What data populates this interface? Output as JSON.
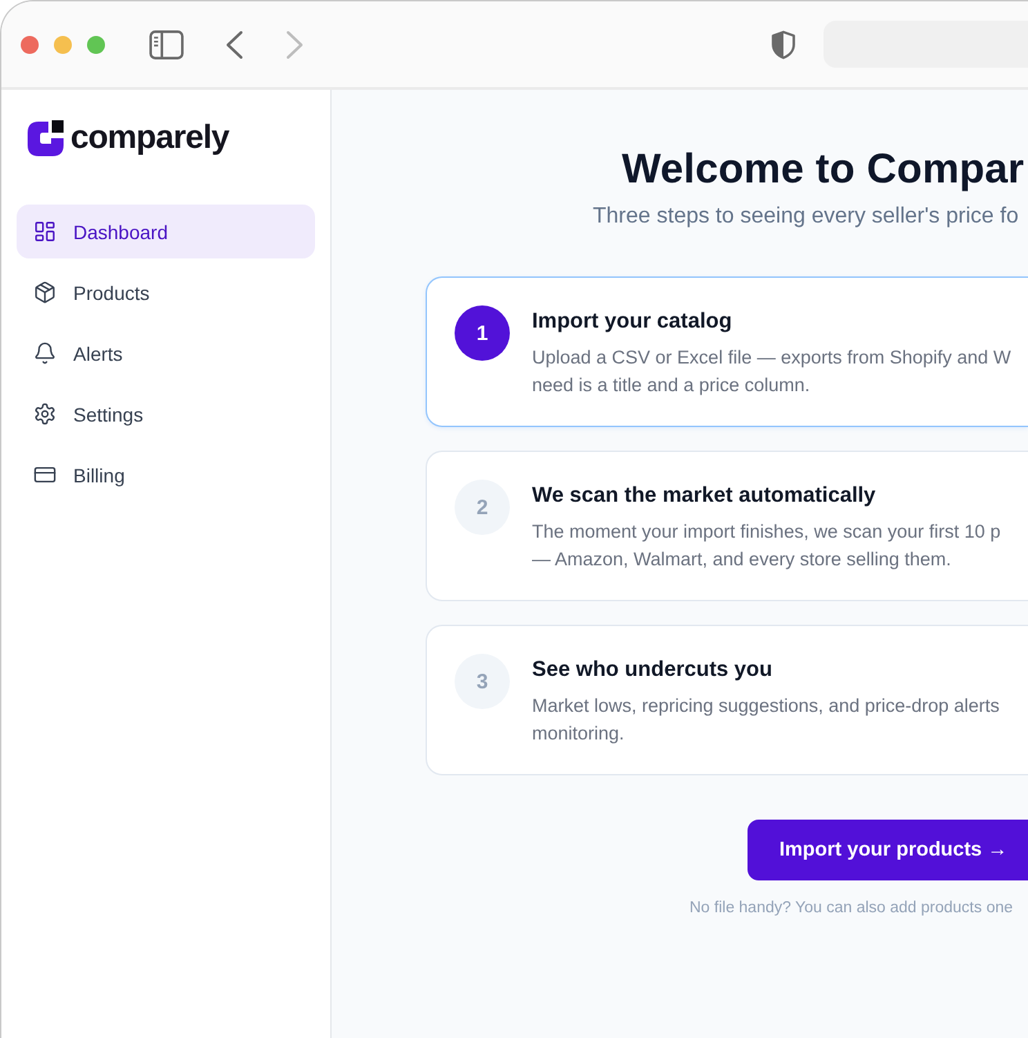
{
  "browser": {
    "controls": [
      {
        "kind": "sidebar",
        "disabled": false
      },
      {
        "kind": "back",
        "disabled": false
      },
      {
        "kind": "forward",
        "disabled": true
      }
    ]
  },
  "sidebar": {
    "logo": "comparely",
    "items": [
      {
        "kind": "dashboard",
        "label": "Dashboard",
        "selected": true
      },
      {
        "kind": "products",
        "label": "Products",
        "selected": false
      },
      {
        "kind": "alerts",
        "label": "Alerts",
        "selected": false
      },
      {
        "kind": "settings",
        "label": "Settings",
        "selected": false
      },
      {
        "kind": "billing",
        "label": "Billing",
        "selected": false
      }
    ]
  },
  "main": {
    "title": "Welcome to Compar",
    "subtitle": "Three steps to seeing every seller's price fo",
    "steps": [
      {
        "number": "1",
        "title": "Import your catalog",
        "description": [
          "Upload a CSV or Excel file — exports from Shopify and W",
          "need is a title and a price column."
        ],
        "current": true
      },
      {
        "number": "2",
        "title": "We scan the market automatically",
        "description": [
          "The moment your import finishes, we scan your first 10 p",
          "— Amazon, Walmart, and every store selling them."
        ],
        "current": false
      },
      {
        "number": "3",
        "title": "See who undercuts you",
        "description": [
          "Market lows, repricing suggestions, and price-drop alerts",
          "monitoring."
        ],
        "current": false
      }
    ],
    "primary_button": "Import your products →",
    "note": "No file handy? You can also add products one"
  }
}
